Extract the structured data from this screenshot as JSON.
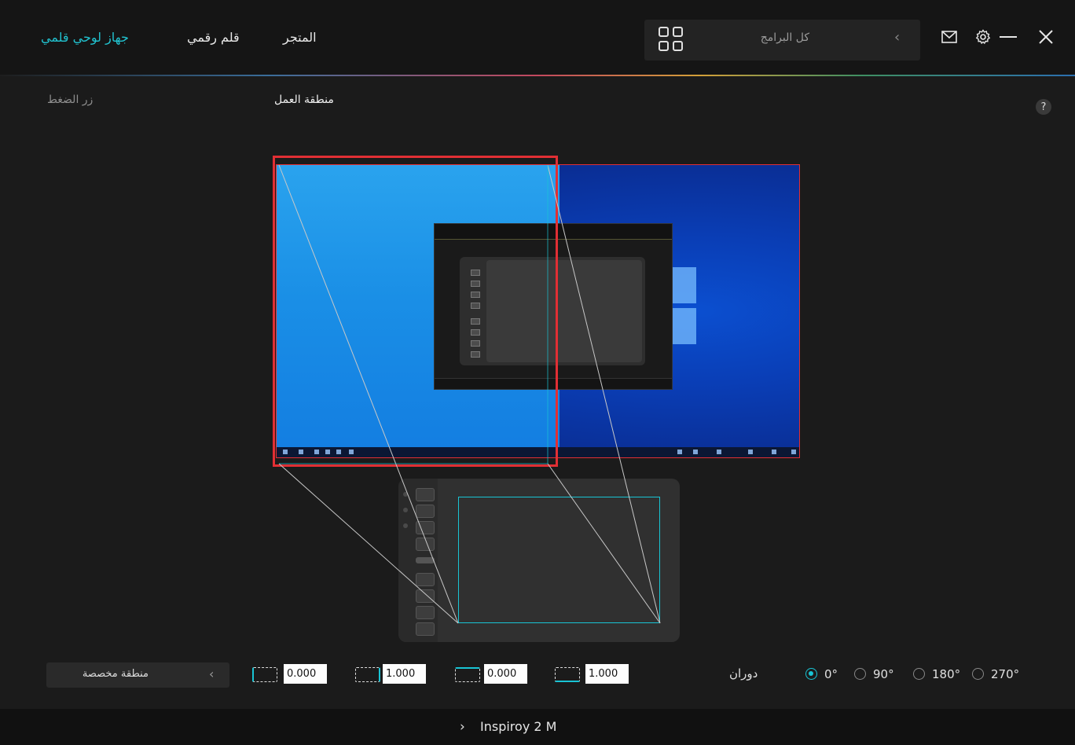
{
  "topbar": {
    "nav": [
      {
        "label": "جهاز لوحي قلمي",
        "active": true
      },
      {
        "label": "قلم رقمي",
        "active": false
      },
      {
        "label": "المتجر",
        "active": false
      }
    ],
    "search": {
      "text": "كل البرامج",
      "icon": "apps-grid-icon"
    },
    "icons": [
      "close-icon",
      "minimize-icon",
      "gear-icon",
      "mail-icon"
    ]
  },
  "content": {
    "section_left": "زر الضغط",
    "section_center": "منطقة العمل",
    "help": "?"
  },
  "controls": {
    "area_preset": "منطقة مخصصة",
    "values": [
      "0.000",
      "1.000",
      "0.000",
      "1.000"
    ],
    "rotation_label": "دوران",
    "rotation_options": [
      "0°",
      "90°",
      "180°",
      "270°"
    ],
    "rotation_selected": "0°"
  },
  "footer": {
    "device": "Inspiroy 2 M"
  },
  "colors": {
    "accent": "#19c4d4",
    "active_nav": "#21c2cf",
    "highlight_border": "#e12f34",
    "background": "#1b1b1b"
  }
}
